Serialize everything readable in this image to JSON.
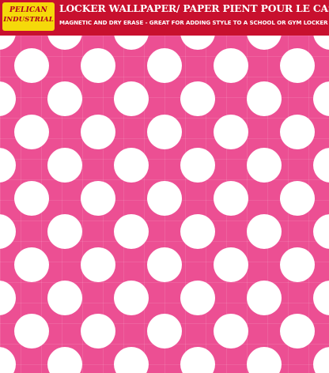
{
  "brand": {
    "line1": "PELICAN",
    "line2": "INDUSTRIAL"
  },
  "header": {
    "title": "LOCKER WALLPAPER/ PAPER PIENT POUR LE CASIER",
    "subtitle": "MAGNETIC AND DRY ERASE - GREAT FOR ADDING STYLE TO A SCHOOL OR GYM LOCKER"
  },
  "pattern": {
    "background_color": "#ec4f93",
    "dot_color": "#ffffff",
    "header_color": "#c8102e",
    "logo_color": "#f5d90a"
  }
}
